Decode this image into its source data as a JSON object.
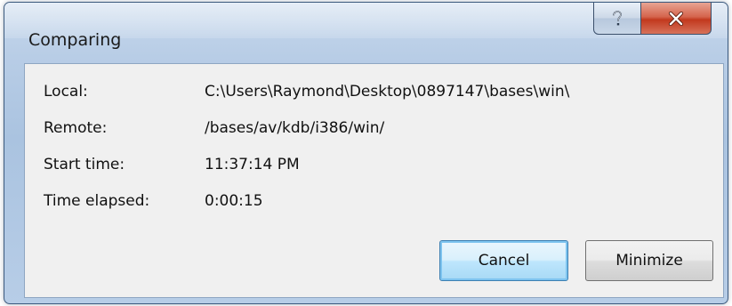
{
  "window": {
    "title": "Comparing",
    "help_icon": "help-icon",
    "close_icon": "close-icon"
  },
  "fields": [
    {
      "label": "Local:",
      "value": "C:\\Users\\Raymond\\Desktop\\0897147\\bases\\win\\"
    },
    {
      "label": "Remote:",
      "value": "/bases/av/kdb/i386/win/"
    },
    {
      "label": "Start time:",
      "value": "11:37:14 PM"
    },
    {
      "label": "Time elapsed:",
      "value": "0:00:15"
    }
  ],
  "buttons": {
    "cancel": "Cancel",
    "minimize": "Minimize"
  },
  "colors": {
    "frame": "#b8cde6",
    "content_bg": "#f0f0f0",
    "close_button": "#c2391e",
    "default_button": "#3c7fb1"
  }
}
